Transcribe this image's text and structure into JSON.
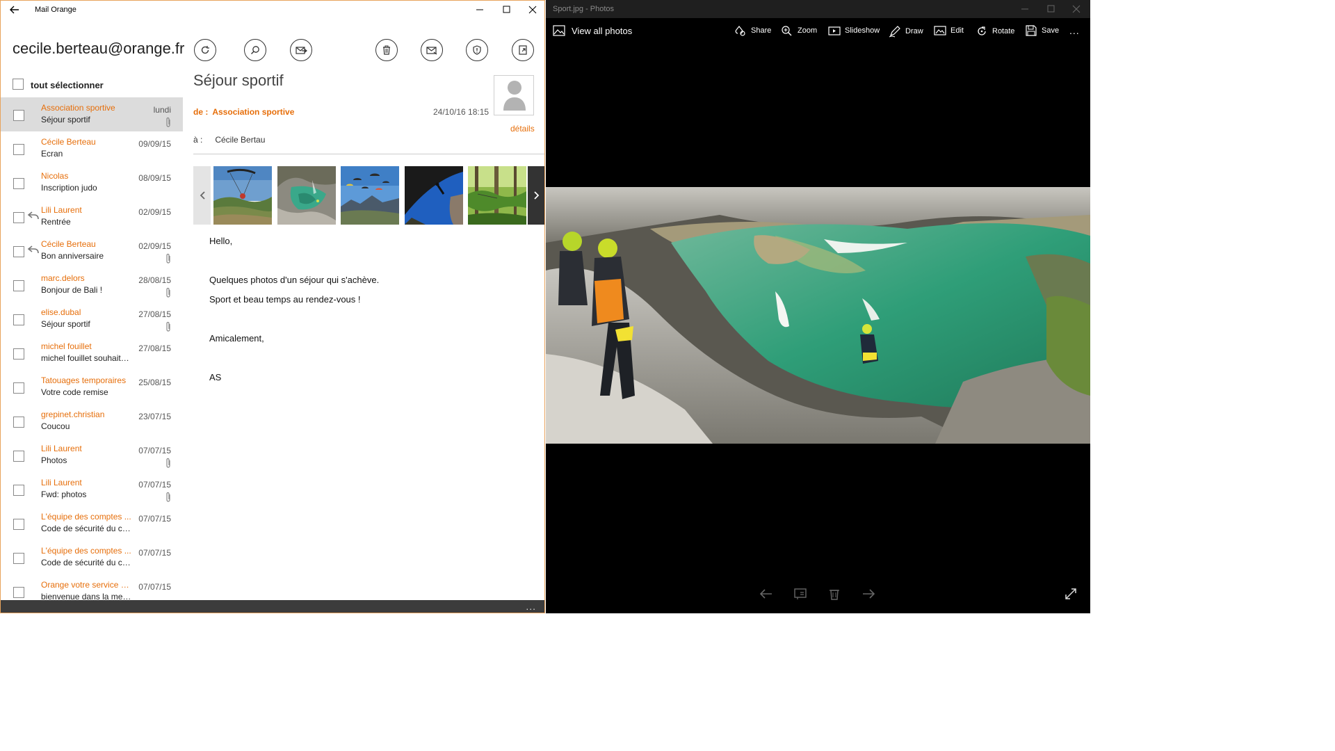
{
  "mail": {
    "app_title": "Mail Orange",
    "account": "cecile.berteau@orange.fr",
    "select_all": "tout sélectionner",
    "toolbar": [
      "refresh-icon",
      "search-icon",
      "move-icon",
      "delete-icon",
      "mark-unread-icon",
      "spam-shield-icon",
      "export-icon"
    ],
    "messages": [
      {
        "sender": "Association sportive",
        "subject": "Séjour sportif",
        "date": "lundi",
        "attachment": true,
        "replied": false,
        "selected": true
      },
      {
        "sender": "Cécile Berteau",
        "subject": "Ecran",
        "date": "09/09/15",
        "attachment": false,
        "replied": false
      },
      {
        "sender": "Nicolas",
        "subject": "Inscription judo",
        "date": "08/09/15",
        "attachment": false,
        "replied": false
      },
      {
        "sender": "Lili Laurent",
        "subject": "Rentrée",
        "date": "02/09/15",
        "attachment": false,
        "replied": true
      },
      {
        "sender": "Cécile Berteau",
        "subject": "Bon anniversaire",
        "date": "02/09/15",
        "attachment": true,
        "replied": true
      },
      {
        "sender": "marc.delors",
        "subject": "Bonjour de Bali !",
        "date": "28/08/15",
        "attachment": true,
        "replied": false
      },
      {
        "sender": "elise.dubal",
        "subject": "Séjour sportif",
        "date": "27/08/15",
        "attachment": true,
        "replied": false
      },
      {
        "sender": "michel fouillet",
        "subject": "michel fouillet souhaiter...",
        "date": "27/08/15",
        "attachment": false,
        "replied": false
      },
      {
        "sender": "Tatouages temporaires",
        "subject": "Votre code remise",
        "date": "25/08/15",
        "attachment": false,
        "replied": false
      },
      {
        "sender": "grepinet.christian",
        "subject": "Coucou",
        "date": "23/07/15",
        "attachment": false,
        "replied": false
      },
      {
        "sender": "Lili Laurent",
        "subject": "Photos",
        "date": "07/07/15",
        "attachment": true,
        "replied": false
      },
      {
        "sender": "Lili Laurent",
        "subject": "Fwd: photos",
        "date": "07/07/15",
        "attachment": true,
        "replied": false
      },
      {
        "sender": "L'équipe des comptes ...",
        "subject": "Code de sécurité du co...",
        "date": "07/07/15",
        "attachment": false,
        "replied": false
      },
      {
        "sender": "L'équipe des comptes ...",
        "subject": "Code de sécurité du co...",
        "date": "07/07/15",
        "attachment": false,
        "replied": false
      },
      {
        "sender": "Orange votre service cli...",
        "subject": "bienvenue dans la mes...",
        "date": "07/07/15",
        "attachment": false,
        "replied": false
      }
    ],
    "reader": {
      "subject": "Séjour sportif",
      "from_label": "de :",
      "from_name": "Association sportive",
      "date": "24/10/16 18:15",
      "details_link": "détails",
      "to_label": "à :",
      "to_name": "Cécile Bertau",
      "attachments": [
        "paragliding",
        "canyoning",
        "parachutes",
        "climbing",
        "treetop-course"
      ],
      "body": [
        "Hello,",
        "Quelques photos d'un séjour qui s'achève.",
        "Sport et beau temps au rendez-vous !",
        "Amicalement,",
        "AS"
      ]
    },
    "more_label": "..."
  },
  "photos": {
    "window_title": "Sport.jpg - Photos",
    "view_all": "View all photos",
    "actions": {
      "share": "Share",
      "zoom": "Zoom",
      "slideshow": "Slideshow",
      "draw": "Draw",
      "edit": "Edit",
      "rotate": "Rotate",
      "save": "Save"
    },
    "more_label": "...",
    "colors": {
      "accent": "#e66e0a",
      "background": "#000000"
    }
  }
}
